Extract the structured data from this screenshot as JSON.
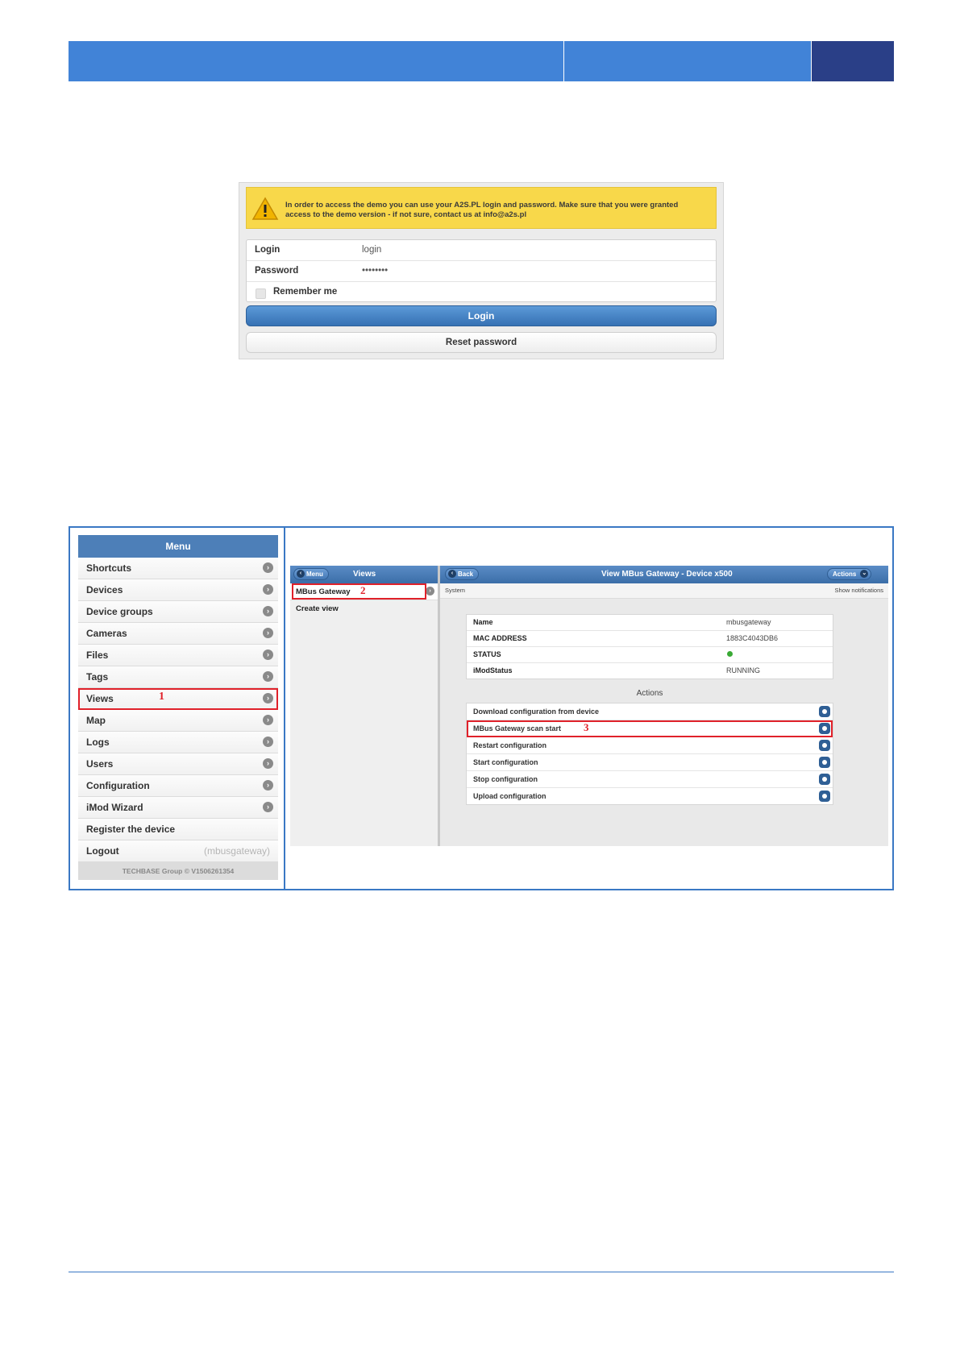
{
  "login": {
    "warning": "In order to access the demo you can use your A2S.PL login and password. Make sure that you were granted access to the demo version - if not sure, contact us at info@a2s.pl",
    "fields": [
      {
        "label": "Login",
        "value": "login"
      },
      {
        "label": "Password",
        "value": "••••••••"
      }
    ],
    "remember_label": "Remember me",
    "login_button": "Login",
    "reset_button": "Reset password"
  },
  "menu": {
    "title": "Menu",
    "items": [
      {
        "label": "Shortcuts"
      },
      {
        "label": "Devices"
      },
      {
        "label": "Device groups"
      },
      {
        "label": "Cameras"
      },
      {
        "label": "Files"
      },
      {
        "label": "Tags"
      },
      {
        "label": "Views"
      },
      {
        "label": "Map"
      },
      {
        "label": "Logs"
      },
      {
        "label": "Users"
      },
      {
        "label": "Configuration"
      },
      {
        "label": "iMod Wizard"
      },
      {
        "label": "Register the device"
      },
      {
        "label": "Logout",
        "note": "(mbusgateway)"
      }
    ],
    "footer": "TECHBASE Group © V1506261354",
    "marker": "1"
  },
  "views": {
    "menu_button": "Menu",
    "title": "Views",
    "items": [
      "MBus Gateway",
      "Create view"
    ],
    "marker": "2"
  },
  "detail": {
    "back_button": "Back",
    "title": "View MBus Gateway - Device x500",
    "actions_button": "Actions",
    "tab": "System",
    "notifications": "Show notifications",
    "info": [
      {
        "key": "Name",
        "value": "mbusgateway"
      },
      {
        "key": "MAC ADDRESS",
        "value": "1883C4043DB6"
      },
      {
        "key": "STATUS",
        "value": ""
      },
      {
        "key": "iModStatus",
        "value": "RUNNING"
      }
    ],
    "status_color": "#3aaa35",
    "actions_title": "Actions",
    "actions": [
      "Download configuration from device",
      "MBus Gateway scan start",
      "Restart configuration",
      "Start configuration",
      "Stop configuration",
      "Upload configuration"
    ],
    "marker": "3"
  },
  "colors": {
    "header_blue": "#4183d7",
    "header_navy": "#2a3f87",
    "highlight_red": "#e0212a",
    "warning_yellow": "#f8d84a"
  }
}
